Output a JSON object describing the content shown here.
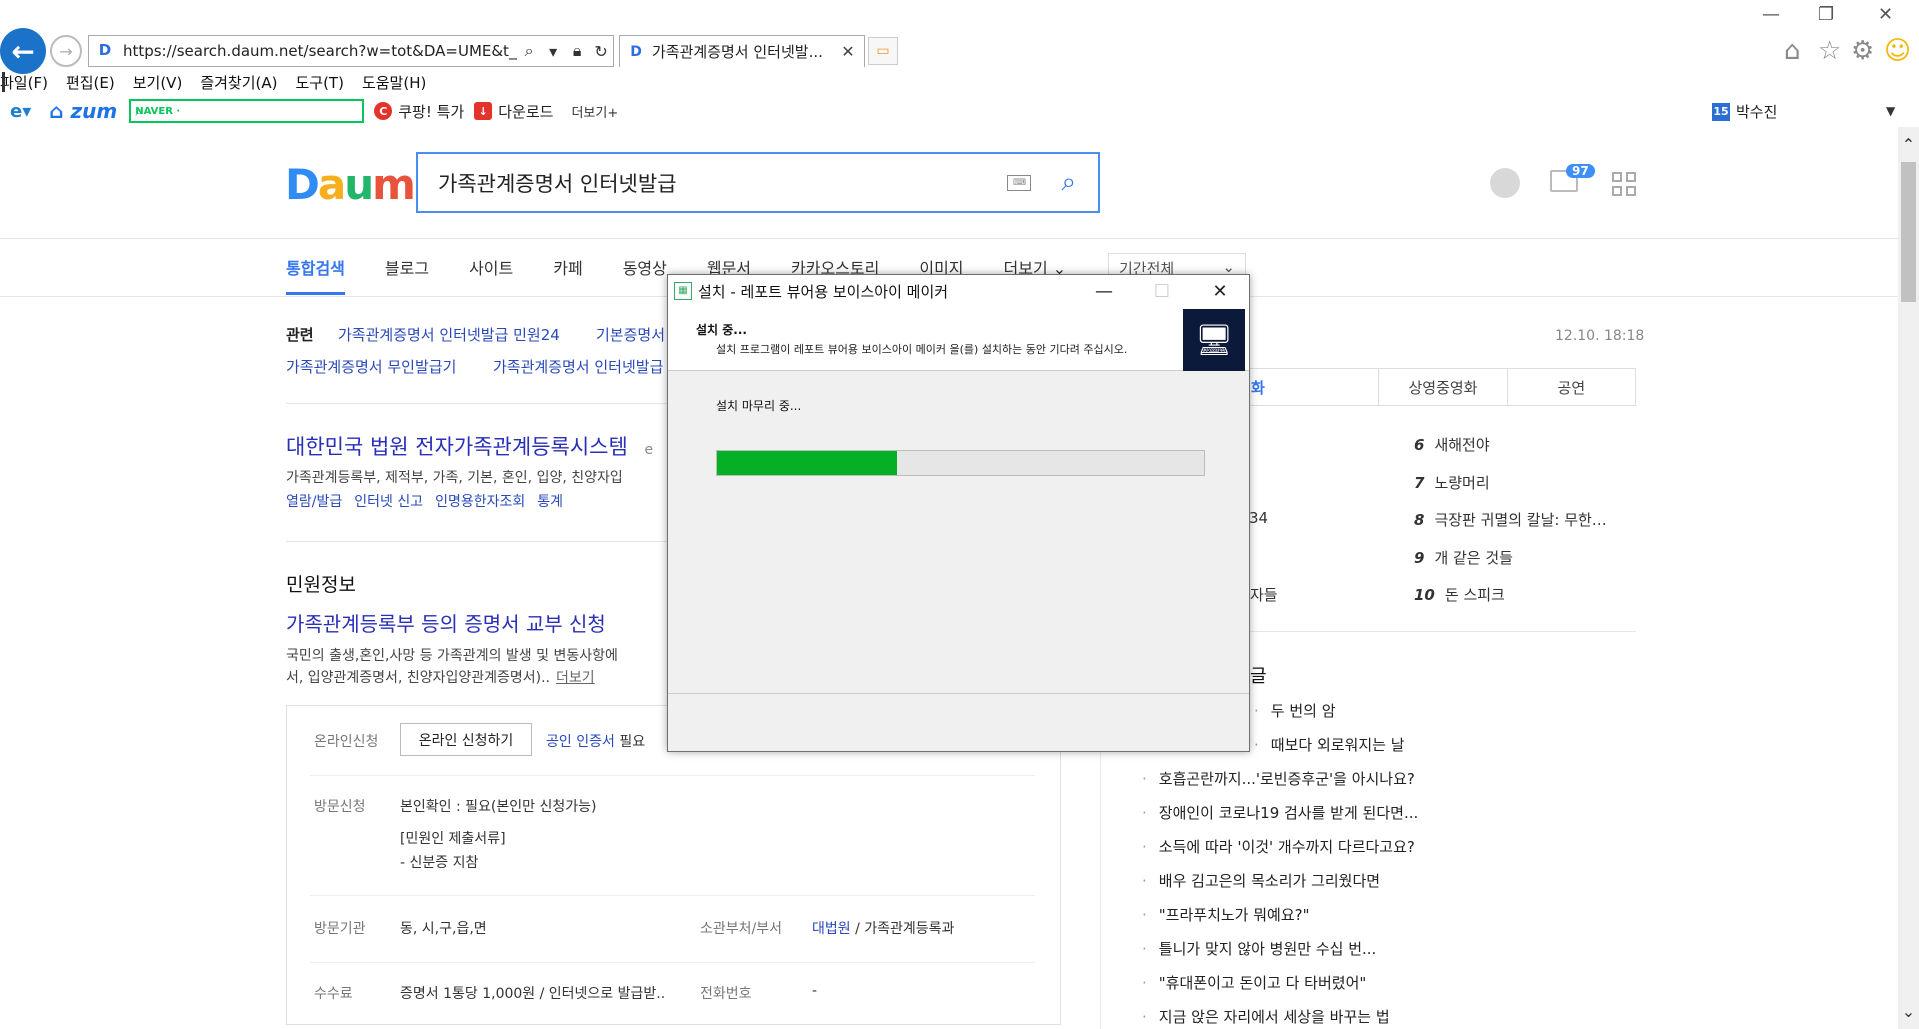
{
  "browser": {
    "url": "https://search.daum.net/search?w=tot&DA=UME&t__nil_s",
    "tab_title": "가족관계증명서 인터넷발...",
    "menu": [
      "파일(F)",
      "편집(E)",
      "보기(V)",
      "즐겨찾기(A)",
      "도구(T)",
      "도움말(H)"
    ],
    "favorites": {
      "naver_label": "NAVER ·",
      "coupang": "쿠팡! 특가",
      "download": "다운로드",
      "more": "더보기+"
    },
    "user": {
      "badge": "15",
      "name": "박수진"
    }
  },
  "daum": {
    "query": "가족관계증명서 인터넷발급",
    "mail_count": "97",
    "tabs": [
      "통합검색",
      "블로그",
      "사이트",
      "카페",
      "동영상",
      "웹문서",
      "카카오스토리",
      "이미지",
      "더보기 ⌄"
    ],
    "period": "기간전체",
    "related_label": "관련",
    "related_links": [
      "가족관계증명서 인터넷발급 민원24",
      "기본증명서",
      "가족관계증명서 무인발급기",
      "가족관계증명서 인터넷발급"
    ],
    "result": {
      "title": "대한민국 법원 전자가족관계등록시스템",
      "title_suffix": "e",
      "desc": "가족관계등록부, 제적부, 가족, 기본, 혼인, 입양, 친양자입",
      "links": [
        "열람/발급",
        "인터넷 신고",
        "인명용한자조회",
        "통계"
      ]
    },
    "civil": {
      "heading": "민원정보",
      "title": "가족관계등록부 등의 증명서 교부 신청",
      "desc1": "국민의 출생,혼인,사망 등 가족관계의 발생 및 변동사항에",
      "desc2": "서, 입양관계증명서, 친양자입양관계증명서)..",
      "more": "더보기",
      "online_label": "온라인신청",
      "online_button": "온라인 신청하기",
      "cert_link": "공인 인증서",
      "cert_suffix": "필요",
      "visit_label": "방문신청",
      "visit_val1": "본인확인 : 필요(본인만 신청가능)",
      "visit_val2": "[민원인 제출서류]",
      "visit_val3": "- 신분증 지참",
      "org_label": "방문기관",
      "org_val": "동, 시,구,읍,면",
      "dept_label": "소관부처/부서",
      "dept_link": "대법원",
      "dept_val": "/ 가족관계등록과",
      "fee_label": "수수료",
      "fee_val": "증명서 1통당 1,000원 / 인터넷으로 발급받..",
      "phone_label": "전화번호",
      "phone_val": "-"
    },
    "right": {
      "timestamp": "12.10. 18:18",
      "tabs": [
        "화",
        "상영중영화",
        "공연"
      ],
      "ranks": [
        {
          "num": "6",
          "text": "새해전야"
        },
        {
          "num": "7",
          "text": "노량머리"
        },
        {
          "num": "8",
          "text": "극장판 귀멸의 칼날: 무한…"
        },
        {
          "num": "9",
          "text": "개 같은 것들"
        },
        {
          "num": "10",
          "text": "돈 스피크"
        }
      ],
      "frag1": "34",
      "frag2": "자들",
      "popular_heading": "글",
      "news": [
        "두 번의 암",
        "때보다 외로워지는 날",
        "호흡곤란까지...'로빈증후군'을 아시나요?",
        "장애인이 코로나19 검사를 받게 된다면...",
        "소득에 따라 '이것' 개수까지 다르다고요?",
        "배우 김고은의 목소리가 그리웠다면",
        "\"프라푸치노가 뭐예요?\"",
        "틀니가 맞지 않아 병원만 수십 번...",
        "\"휴대폰이고 돈이고 다 타버렸어\"",
        "지금 앉은 자리에서 세상을 바꾸는 법"
      ]
    }
  },
  "installer": {
    "title": "설치 - 레포트 뷰어용 보이스아이 메이커",
    "heading": "설치 중...",
    "sub": "설치 프로그램이 레포트 뷰어용 보이스아이 메이커 을(를) 설치하는 동안 기다려 주십시오.",
    "status": "설치 마무리 중...",
    "progress": 0.37,
    "progress_color": "#06b025"
  }
}
